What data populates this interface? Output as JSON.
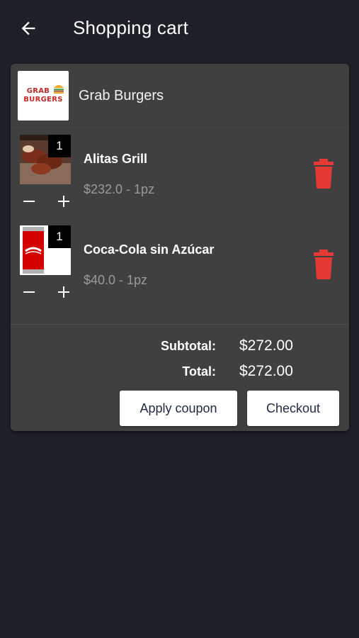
{
  "header": {
    "title": "Shopping cart",
    "back_icon": "arrow-left-icon"
  },
  "store": {
    "name": "Grab Burgers",
    "logo_line1": "GRAB",
    "logo_line2": "BURGERS",
    "logo_color": "#c62828"
  },
  "items": [
    {
      "name": "Alitas Grill",
      "price": "$232.0 - 1pz",
      "quantity": "1",
      "image": "chicken-wings-photo"
    },
    {
      "name": "Coca-Cola sin Azúcar",
      "price": "$40.0 - 1pz",
      "quantity": "1",
      "image": "coca-cola-can-photo"
    }
  ],
  "summary": {
    "subtotal_label": "Subtotal:",
    "subtotal_value": "$272.00",
    "total_label": "Total:",
    "total_value": "$272.00"
  },
  "actions": {
    "apply_coupon": "Apply coupon",
    "checkout": "Checkout"
  },
  "colors": {
    "background": "#1f1f27",
    "card": "#404040",
    "delete": "#e53935",
    "button_text": "#1e2a44"
  }
}
